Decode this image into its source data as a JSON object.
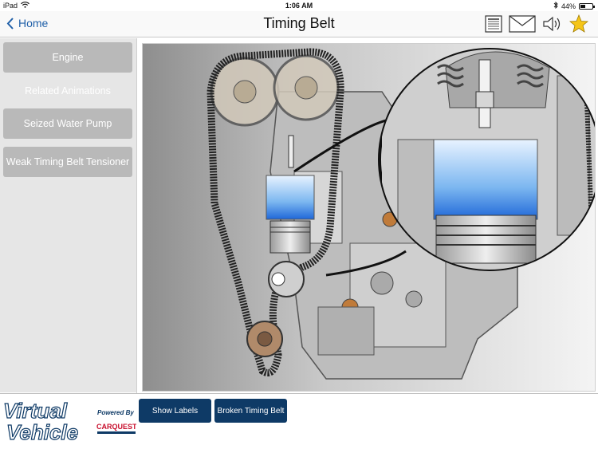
{
  "status": {
    "device": "iPad",
    "time": "1:06 AM",
    "battery_text": "44%",
    "battery_level": 0.44
  },
  "nav": {
    "back_label": "Home",
    "title": "Timing Belt",
    "icons": [
      "notes-icon",
      "mail-icon",
      "speaker-icon",
      "star-icon"
    ]
  },
  "sidebar": {
    "primary": "Engine",
    "section_label": "Related Animations",
    "items": [
      {
        "label": "Seized Water Pump"
      },
      {
        "label": "Weak Timing Belt Tensioner"
      }
    ]
  },
  "logo": {
    "line1": "Virtual",
    "line2": "Vehicle",
    "powered": "Powered By",
    "brand": "CARQUEST"
  },
  "bottom_buttons": [
    {
      "label": "Show Labels"
    },
    {
      "label": "Broken Timing Belt"
    }
  ],
  "colors": {
    "accent": "#1f5fa8",
    "button_dark": "#0e3a66",
    "sidebar_button": "#b9b9b9",
    "star": "#f5c518"
  }
}
